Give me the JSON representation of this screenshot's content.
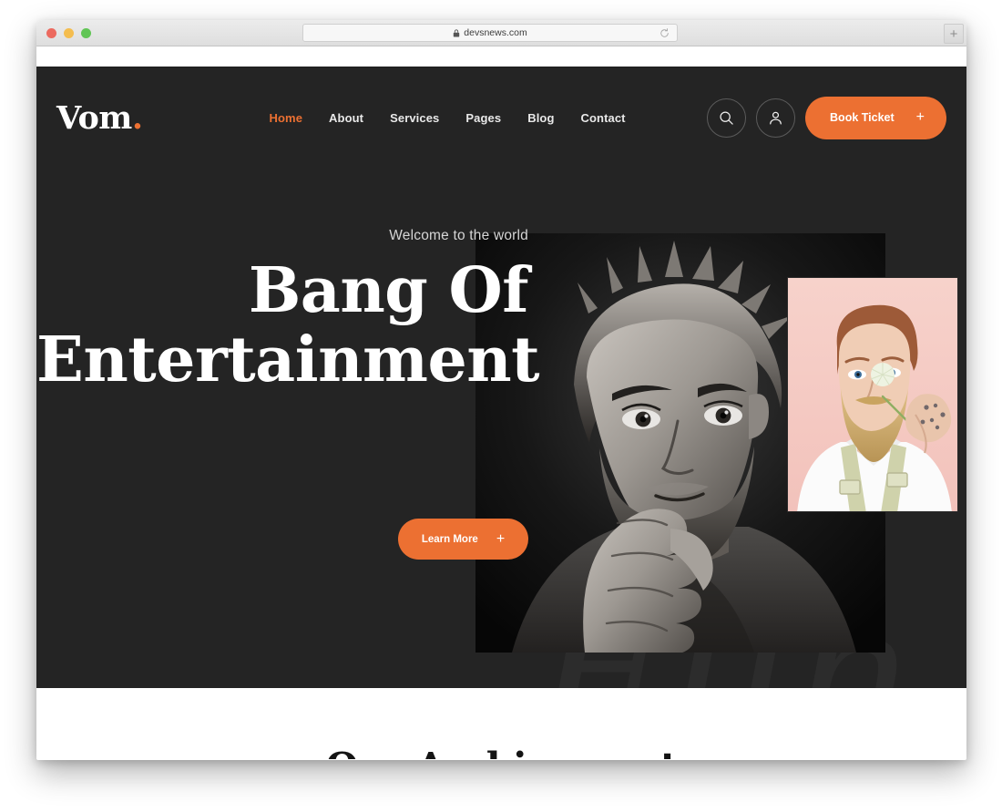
{
  "browser": {
    "url": "devsnews.com",
    "lock_icon": "lock-icon",
    "reload_icon": "reload-icon",
    "new_tab_label": "+",
    "traffic_lights": [
      "close",
      "minimize",
      "maximize"
    ]
  },
  "site": {
    "logo_text": "Vom",
    "logo_dot": ".",
    "accent_color": "#ec7032",
    "background_color": "#242424",
    "nav": [
      {
        "label": "Home",
        "active": true
      },
      {
        "label": "About",
        "active": false
      },
      {
        "label": "Services",
        "active": false
      },
      {
        "label": "Pages",
        "active": false
      },
      {
        "label": "Blog",
        "active": false
      },
      {
        "label": "Contact",
        "active": false
      }
    ],
    "actions": {
      "search_icon": "search-icon",
      "account_icon": "user-icon",
      "book_ticket_label": "Book Ticket",
      "book_ticket_plus": "+"
    }
  },
  "hero": {
    "eyebrow": "Welcome to the world",
    "title_line1": "Bang Of",
    "title_line2": "Entertainment",
    "cta_label": "Learn More",
    "cta_plus": "+",
    "watermark_text": "Fun",
    "main_image_alt": "black-and-white portrait of bearded man with hand on chin",
    "overlay_image_alt": "bearded man on pink background holding a dandelion"
  },
  "section_below": {
    "title": "Our Archivement"
  }
}
